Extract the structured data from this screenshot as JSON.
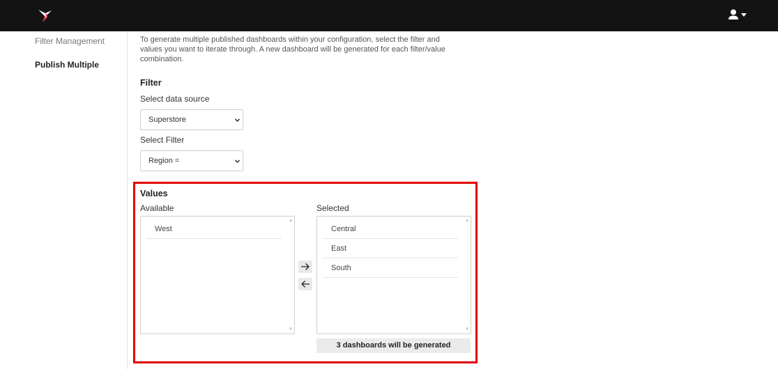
{
  "sidebar": {
    "items": [
      {
        "label": "Filter Management"
      },
      {
        "label": "Publish Multiple"
      }
    ]
  },
  "main": {
    "intro": "To generate multiple published dashboards within your configuration, select the filter and values you want to iterate through. A new dashboard will be generated for each filter/value combination.",
    "filter": {
      "title": "Filter",
      "data_source_label": "Select data source",
      "data_source_value": "Superstore",
      "filter_label": "Select Filter",
      "filter_value": "Region ="
    },
    "values": {
      "title": "Values",
      "available_label": "Available",
      "selected_label": "Selected",
      "available_items": [
        "West"
      ],
      "selected_items": [
        "Central",
        "East",
        "South"
      ],
      "summary": "3 dashboards will be generated"
    }
  },
  "icons": {
    "logo": "hummingbird-logo-icon",
    "user": "user-icon",
    "user_menu_caret": "caret-down-icon",
    "move_right": "arrow-right-icon",
    "move_left": "arrow-left-icon",
    "select_chevron": "chevron-down-icon"
  },
  "colors": {
    "topbar": "#131313",
    "logo_accent": "#e03a48",
    "highlight_border": "#e00000"
  }
}
